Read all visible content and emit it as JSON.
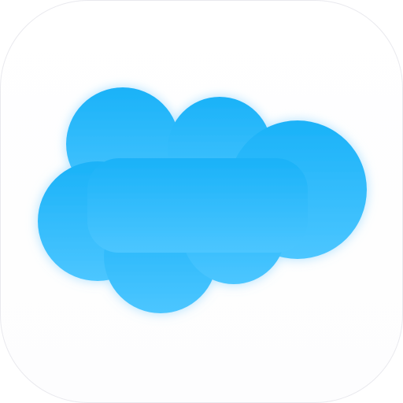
{
  "app_icon": {
    "name": "salesforce-cloud-icon",
    "background_color": "#ffffff",
    "border_color": "#e9e9ee"
  },
  "logo": {
    "icon": "cloud-icon",
    "fill_top": "#1ab2f8",
    "fill_bottom": "#4cc6ff",
    "glow_color": "#9fdcff"
  }
}
